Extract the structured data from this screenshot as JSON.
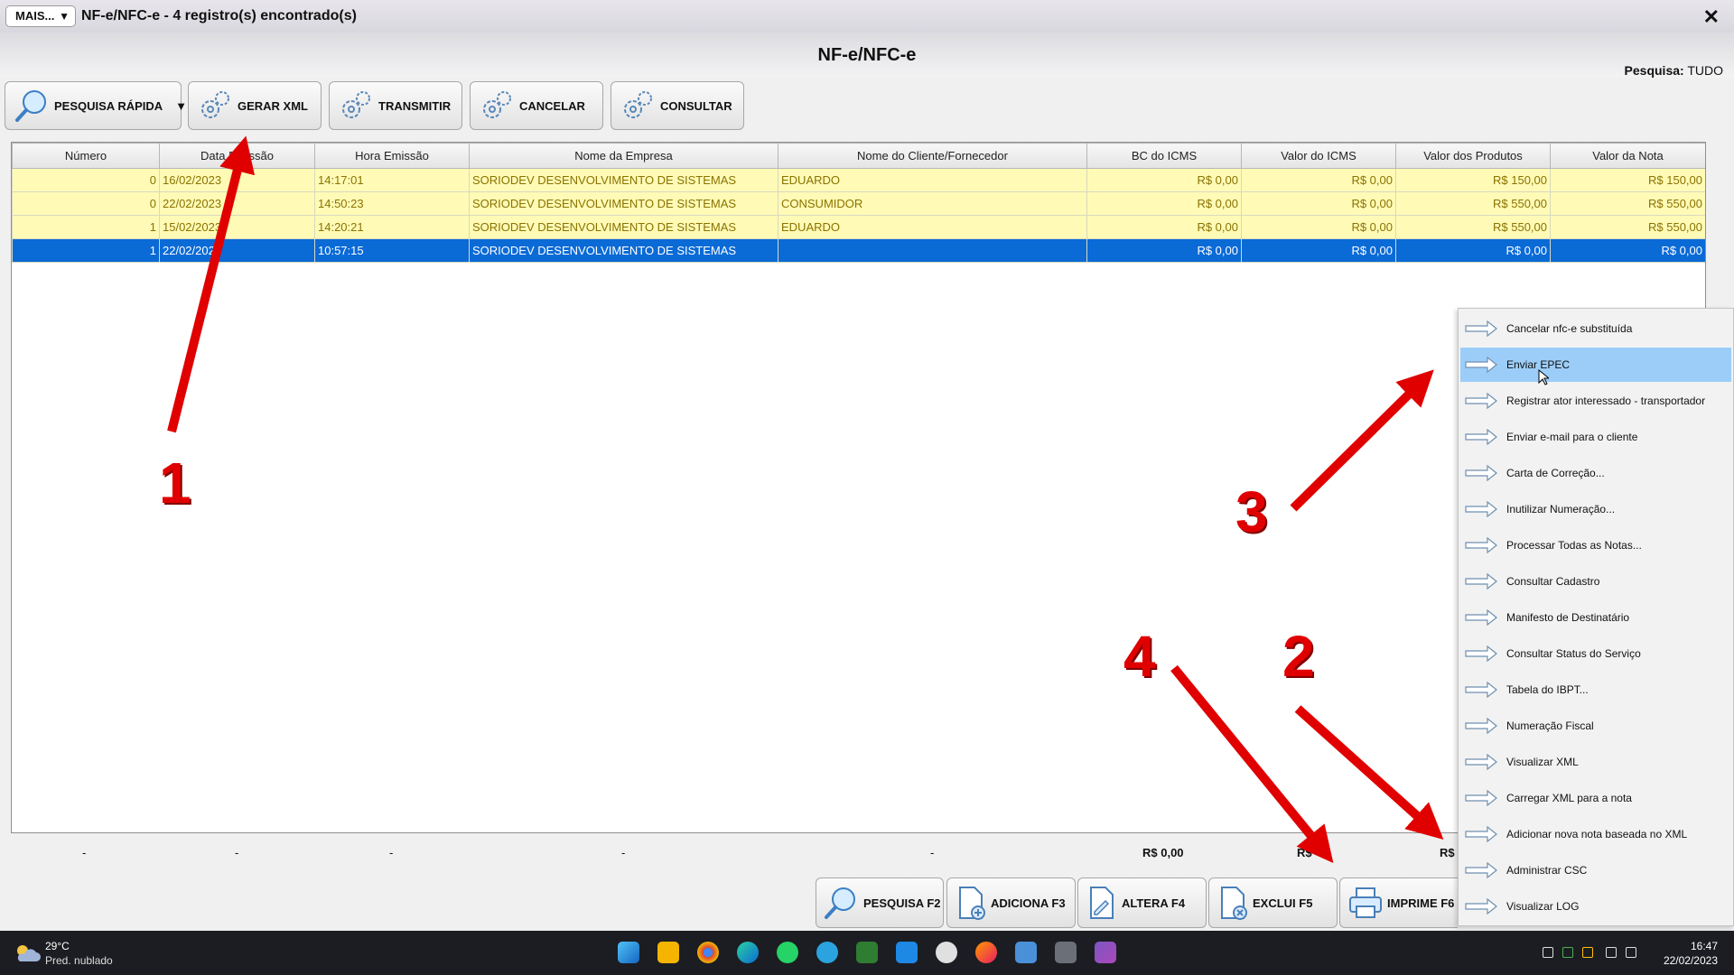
{
  "window": {
    "more_label": "MAIS...",
    "title": "NF-e/NFC-e - 4 registro(s) encontrado(s)",
    "close": "✕"
  },
  "header": {
    "title": "NF-e/NFC-e",
    "search_scope_label": "Pesquisa:",
    "search_scope_value": "TUDO"
  },
  "toolbar": {
    "quick_search": "PESQUISA RÁPIDA",
    "generate_xml": "GERAR XML",
    "transmit": "TRANSMITIR",
    "cancel": "CANCELAR",
    "query": "CONSULTAR"
  },
  "table": {
    "columns": [
      "Número",
      "Data Emissão",
      "Hora Emissão",
      "Nome da Empresa",
      "Nome do Cliente/Fornecedor",
      "BC do ICMS",
      "Valor do ICMS",
      "Valor dos Produtos",
      "Valor da Nota"
    ],
    "rows": [
      [
        "0",
        "16/02/2023",
        "14:17:01",
        "SORIODEV DESENVOLVIMENTO DE SISTEMAS",
        "EDUARDO",
        "R$ 0,00",
        "R$ 0,00",
        "R$ 150,00",
        "R$ 150,00"
      ],
      [
        "0",
        "22/02/2023",
        "14:50:23",
        "SORIODEV DESENVOLVIMENTO DE SISTEMAS",
        "CONSUMIDOR",
        "R$ 0,00",
        "R$ 0,00",
        "R$ 550,00",
        "R$ 550,00"
      ],
      [
        "1",
        "15/02/2023",
        "14:20:21",
        "SORIODEV DESENVOLVIMENTO DE SISTEMAS",
        "EDUARDO",
        "R$ 0,00",
        "R$ 0,00",
        "R$ 550,00",
        "R$ 550,00"
      ],
      [
        "1",
        "22/02/2023",
        "10:57:15",
        "SORIODEV DESENVOLVIMENTO DE SISTEMAS",
        "",
        "R$ 0,00",
        "R$ 0,00",
        "R$ 0,00",
        "R$ 0,00"
      ]
    ],
    "selected_row": 4
  },
  "totals": {
    "dash": "-",
    "bc_icms": "R$ 0,00",
    "valor_icms": "R$",
    "valor_produtos": "R$"
  },
  "bottom_buttons": {
    "search": "PESQUISA F2",
    "add": "ADICIONA F3",
    "edit": "ALTERA F4",
    "delete": "EXCLUI F5",
    "print": "IMPRIME F6"
  },
  "context_menu": {
    "items": [
      "Cancelar nfc-e substituída",
      "Enviar EPEC",
      "Registrar ator interessado - transportador",
      "Enviar e-mail para o cliente",
      "Carta de Correção...",
      "Inutilizar Numeração...",
      "Processar Todas as Notas...",
      "Consultar Cadastro",
      "Manifesto de Destinatário",
      "Consultar Status do Serviço",
      "Tabela do IBPT...",
      "Numeração Fiscal",
      "Visualizar XML",
      "Carregar XML para a nota",
      "Adicionar nova nota baseada no XML",
      "Administrar CSC",
      "Visualizar LOG"
    ],
    "highlighted_item": "Enviar EPEC"
  },
  "annotations": {
    "n1": "1",
    "n2": "2",
    "n3": "3",
    "n4": "4",
    "color": "#e00000"
  },
  "taskbar": {
    "temperature": "29°C",
    "weather": "Pred. nublado",
    "time": "16:47",
    "date": "22/02/2023"
  },
  "colors": {
    "row_highlight": "#fffbb6",
    "row_text": "#8b7200",
    "selected_row": "#0a6ad6",
    "menu_highlight": "#9bcdf8"
  }
}
